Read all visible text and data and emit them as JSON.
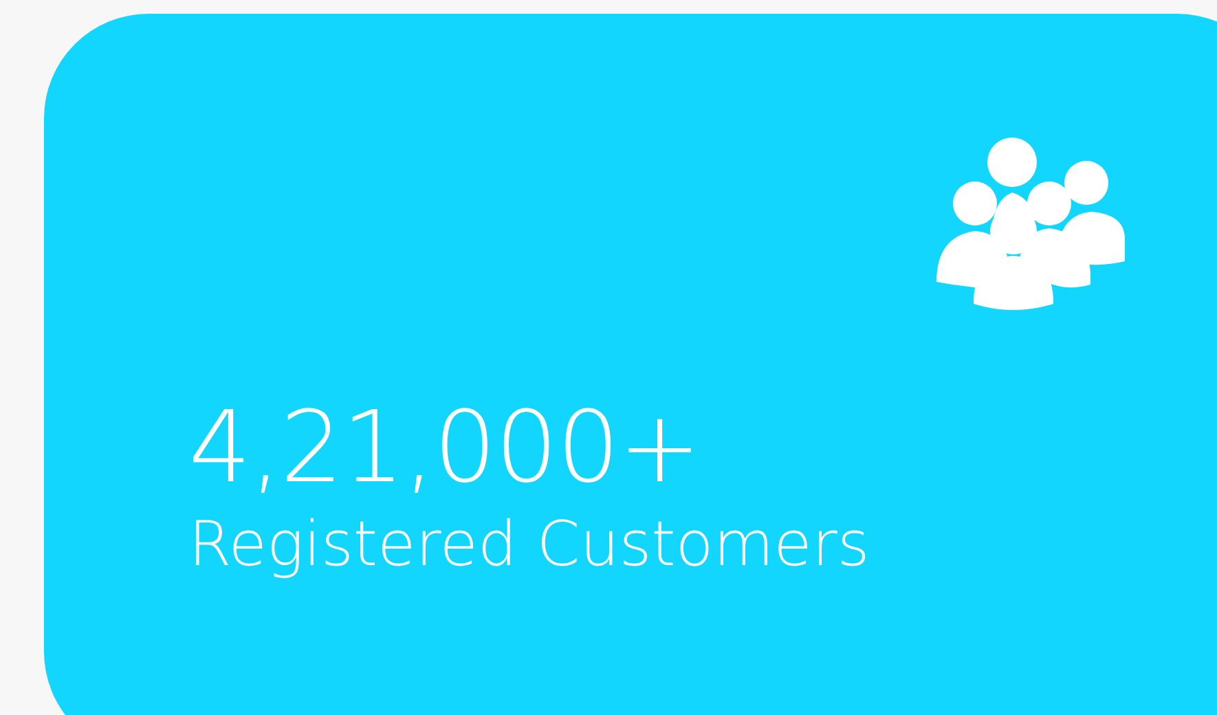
{
  "stat_card": {
    "value": "4,21,000+",
    "label": "Registered Customers"
  }
}
